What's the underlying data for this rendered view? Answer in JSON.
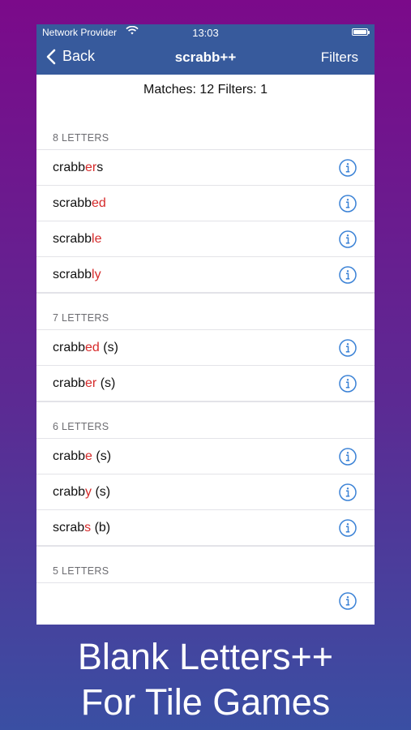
{
  "status_bar": {
    "provider": "Network Provider",
    "time": "13:03"
  },
  "nav": {
    "back_label": "Back",
    "title": "scrabb++",
    "filters_label": "Filters"
  },
  "summary": "Matches: 12 Filters: 1",
  "sections": [
    {
      "header": "8 LETTERS",
      "rows": [
        {
          "base": "crabb",
          "hl": "er",
          "tail": "s"
        },
        {
          "base": "scrabb",
          "hl": "ed",
          "tail": ""
        },
        {
          "base": "scrabb",
          "hl": "le",
          "tail": ""
        },
        {
          "base": "scrabb",
          "hl": "ly",
          "tail": ""
        }
      ]
    },
    {
      "header": "7 LETTERS",
      "rows": [
        {
          "base": "crabb",
          "hl": "ed",
          "tail": " (s)"
        },
        {
          "base": "crabb",
          "hl": "er",
          "tail": " (s)"
        }
      ]
    },
    {
      "header": "6 LETTERS",
      "rows": [
        {
          "base": "crabb",
          "hl": "e",
          "tail": " (s)"
        },
        {
          "base": "crabb",
          "hl": "y",
          "tail": " (s)"
        },
        {
          "base": "scrab",
          "hl": "s",
          "tail": " (b)"
        }
      ]
    },
    {
      "header": "5 LETTERS",
      "rows": [
        {
          "base": "",
          "hl": "",
          "tail": ""
        }
      ]
    }
  ],
  "caption": {
    "line1": "Blank Letters++",
    "line2": "For Tile Games"
  },
  "colors": {
    "nav_bg": "#375a9c",
    "highlight": "#d62a2a",
    "info_icon": "#3b82d6"
  }
}
